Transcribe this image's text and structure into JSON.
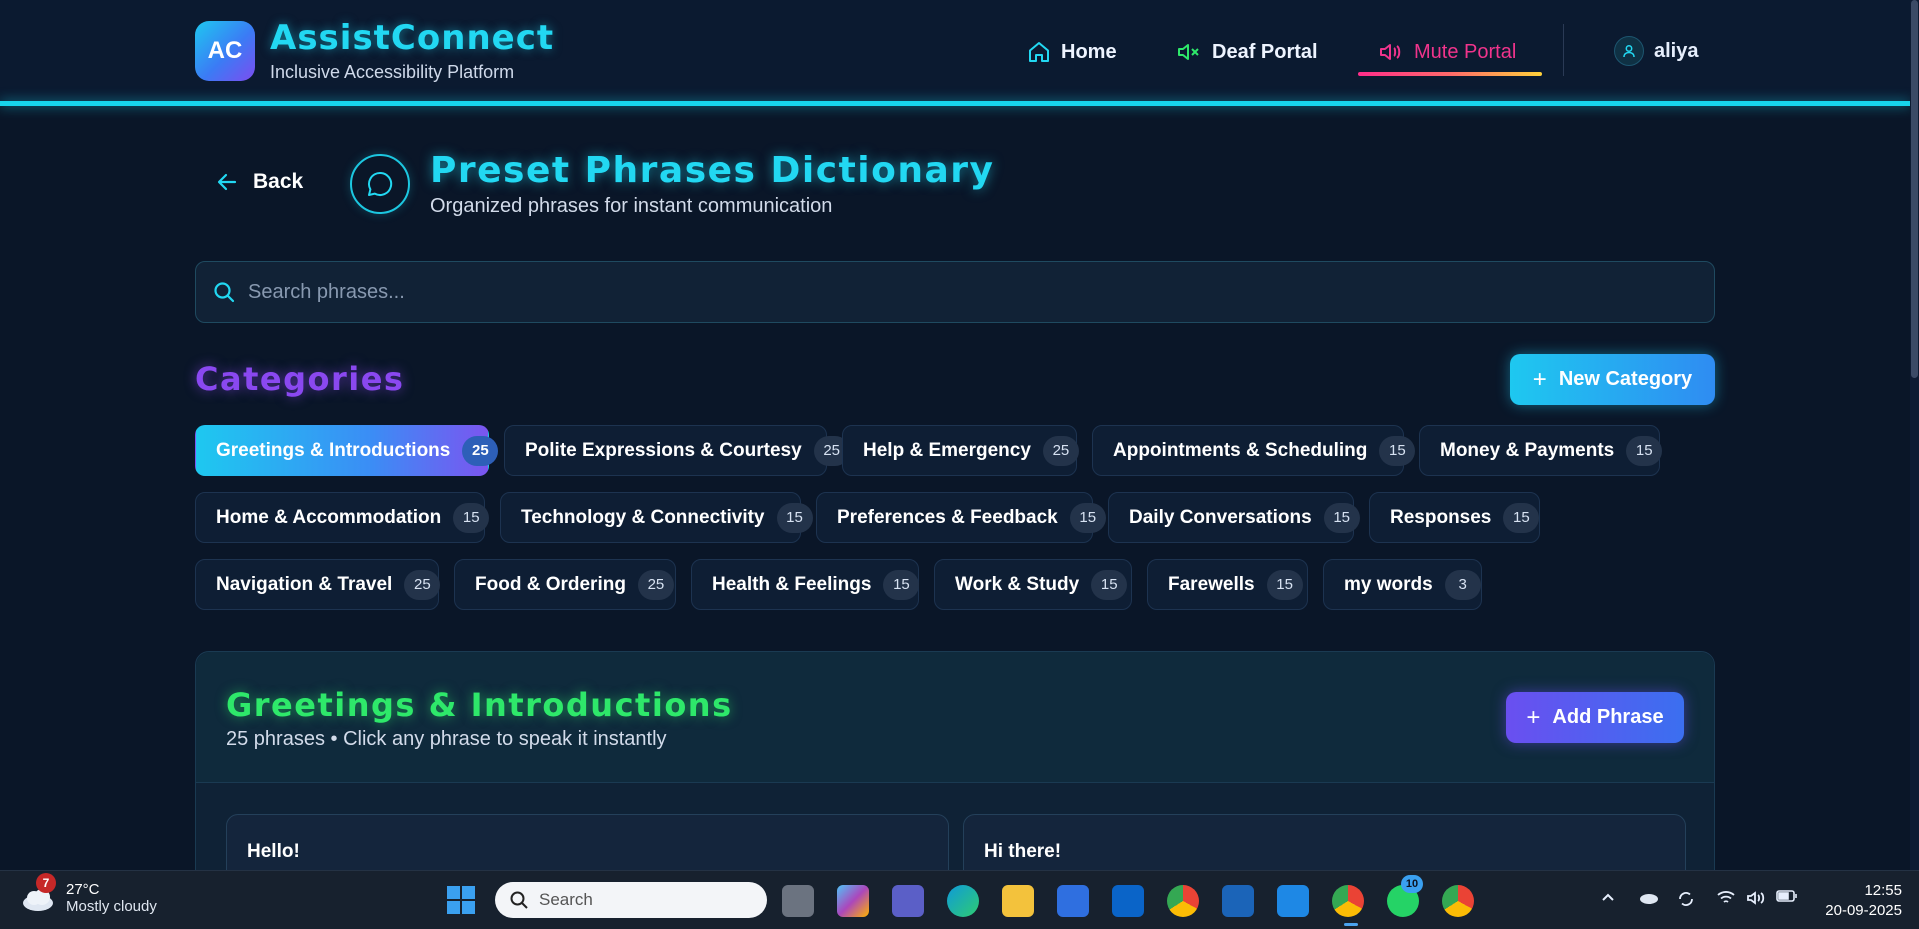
{
  "header": {
    "logo_text": "AC",
    "brand_title": "AssistConnect",
    "brand_subtitle": "Inclusive Accessibility Platform",
    "nav": {
      "home": "Home",
      "deaf": "Deaf Portal",
      "mute": "Mute Portal"
    },
    "user": "aliya"
  },
  "page": {
    "back_label": "Back",
    "title": "Preset Phrases Dictionary",
    "subtitle": "Organized phrases for instant communication",
    "search_placeholder": "Search phrases..."
  },
  "categories": {
    "title": "Categories",
    "new_button": "New Category",
    "items": [
      {
        "label": "Greetings & Introductions",
        "count": "25",
        "active": true
      },
      {
        "label": "Polite Expressions & Courtesy",
        "count": "25"
      },
      {
        "label": "Help & Emergency",
        "count": "25"
      },
      {
        "label": "Appointments & Scheduling",
        "count": "15"
      },
      {
        "label": "Money & Payments",
        "count": "15"
      },
      {
        "label": "Home & Accommodation",
        "count": "15"
      },
      {
        "label": "Technology & Connectivity",
        "count": "15"
      },
      {
        "label": "Preferences & Feedback",
        "count": "15"
      },
      {
        "label": "Daily Conversations",
        "count": "15"
      },
      {
        "label": "Responses",
        "count": "15"
      },
      {
        "label": "Navigation & Travel",
        "count": "25"
      },
      {
        "label": "Food & Ordering",
        "count": "25"
      },
      {
        "label": "Health & Feelings",
        "count": "15"
      },
      {
        "label": "Work & Study",
        "count": "15"
      },
      {
        "label": "Farewells",
        "count": "15"
      },
      {
        "label": "my words",
        "count": "3"
      }
    ]
  },
  "phrases_panel": {
    "title": "Greetings & Introductions",
    "subtitle": "25 phrases • Click any phrase to speak it instantly",
    "add_button": "Add Phrase",
    "phrases": [
      "Hello!",
      "Hi there!"
    ]
  },
  "taskbar": {
    "weather_badge": "7",
    "temperature": "27°C",
    "condition": "Mostly cloudy",
    "search_label": "Search",
    "whatsapp_badge": "10",
    "time": "12:55",
    "date": "20-09-2025"
  },
  "colors": {
    "accent_cyan": "#22d8f2",
    "accent_purple": "#8a48f0",
    "accent_green": "#2ee86a",
    "mute_pink": "#f0348c",
    "background": "#0a1628"
  }
}
